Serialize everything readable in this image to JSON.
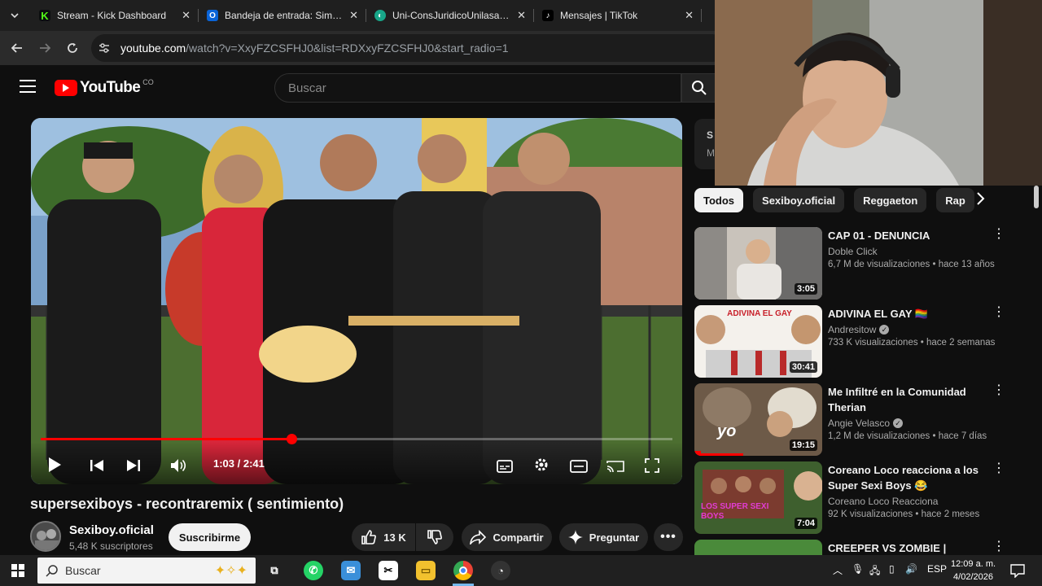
{
  "browser": {
    "tabs": [
      {
        "title": "Stream - Kick Dashboard",
        "icon": "kick-icon",
        "color": "#53fc18"
      },
      {
        "title": "Bandeja de entrada: Simón T",
        "icon": "outlook-icon",
        "color": "#0a64d8"
      },
      {
        "title": "Uni-ConsJuridicoUnilasallist",
        "icon": "globe-icon",
        "color": "#18a689"
      },
      {
        "title": "Mensajes | TikTok",
        "icon": "tiktok-icon",
        "color": "#ffffff"
      }
    ],
    "url_domain": "youtube.com",
    "url_path": "/watch?v=XxyFZCSFHJ0&list=RDXxyFZCSFHJ0&start_radio=1"
  },
  "youtube": {
    "logo_text": "YouTube",
    "country": "CO",
    "search_placeholder": "Buscar",
    "accent": "#ff0000"
  },
  "player": {
    "current_time": "1:03",
    "duration": "2:41",
    "progress_fraction": 0.397
  },
  "video": {
    "title": "supersexiboys - recontraremix ( sentimiento)",
    "channel": "Sexiboy.oficial",
    "subscribers": "5,48 K suscriptores",
    "subscribe_label": "Suscribirme",
    "likes": "13 K",
    "share_label": "Compartir",
    "ask_label": "Preguntar"
  },
  "sidebar": {
    "card_letter": "S",
    "card_sub": "M",
    "chips": [
      "Todos",
      "Sexiboy.oficial",
      "Reggaeton",
      "Rap"
    ],
    "recommendations": [
      {
        "title": "CAP 01 - DENUNCIA",
        "channel": "Doble Click",
        "verified": false,
        "stats": "6,7 M de visualizaciones • hace 13 años",
        "duration": "3:05"
      },
      {
        "title": "ADIVINA EL GAY 🏳️‍🌈",
        "channel": "Andresitow",
        "verified": true,
        "stats": "733 K visualizaciones • hace 2 semanas",
        "duration": "30:41",
        "thumb_text": "ADIVINA EL GAY"
      },
      {
        "title": "Me Infiltré en la Comunidad Therian",
        "channel": "Angie Velasco",
        "verified": true,
        "stats": "1,2 M de visualizaciones • hace 7 días",
        "duration": "19:15",
        "thumb_text": "yo"
      },
      {
        "title": "Coreano Loco reacciona a los Super Sexi Boys 😂",
        "channel": "Coreano Loco Reacciona",
        "verified": false,
        "stats": "92 K visualizaciones • hace 2 meses",
        "duration": "7:04",
        "thumb_text": "LOS SUPER SEXI BOYS"
      },
      {
        "title": "CREEPER VS ZOMBIE |",
        "channel": "",
        "verified": false,
        "stats": "",
        "duration": ""
      }
    ]
  },
  "taskbar": {
    "search_placeholder": "Buscar",
    "language": "ESP",
    "time": "12:09 a. m.",
    "date": "4/02/2026"
  }
}
